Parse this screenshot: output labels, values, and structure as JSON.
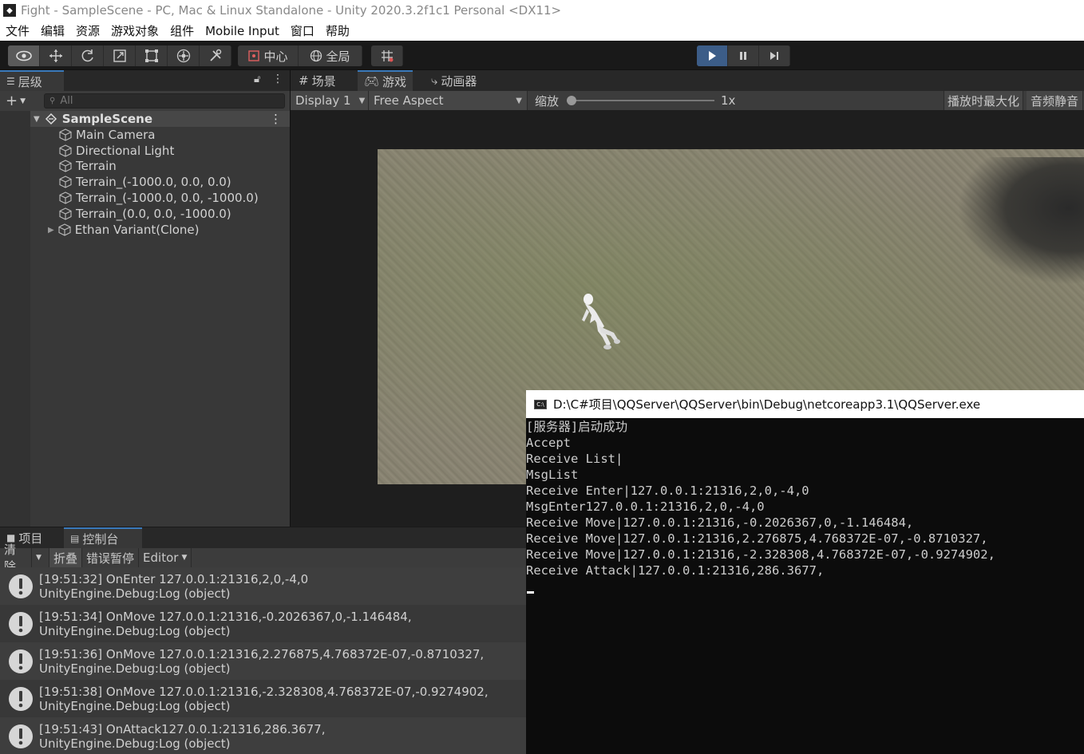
{
  "window": {
    "title": "Fight - SampleScene - PC, Mac & Linux Standalone - Unity 2020.3.2f1c1 Personal <DX11>"
  },
  "menu": [
    "文件",
    "编辑",
    "资源",
    "游戏对象",
    "组件",
    "Mobile Input",
    "窗口",
    "帮助"
  ],
  "toolbar": {
    "pivot_label": "中心",
    "global_label": "全局"
  },
  "hierarchy": {
    "tab_label": "层级",
    "search_placeholder": "All",
    "scene_name": "SampleScene",
    "items": [
      "Main Camera",
      "Directional Light",
      "Terrain",
      "Terrain_(-1000.0, 0.0, 0.0)",
      "Terrain_(-1000.0, 0.0, -1000.0)",
      "Terrain_(0.0, 0.0, -1000.0)",
      "Ethan Variant(Clone)"
    ]
  },
  "game_view": {
    "tabs": [
      "场景",
      "游戏",
      "动画器"
    ],
    "display": "Display 1",
    "aspect": "Free Aspect",
    "scale_label": "缩放",
    "scale_value": "1x",
    "maximize_label": "播放时最大化",
    "mute_label": "音频静音"
  },
  "cmd_window": {
    "title": "D:\\C#项目\\QQServer\\QQServer\\bin\\Debug\\netcoreapp3.1\\QQServer.exe",
    "lines": [
      "[服务器]启动成功",
      "Accept",
      "Receive List|",
      "MsgList",
      "Receive Enter|127.0.0.1:21316,2,0,-4,0",
      "MsgEnter127.0.0.1:21316,2,0,-4,0",
      "Receive Move|127.0.0.1:21316,-0.2026367,0,-1.146484,",
      "Receive Move|127.0.0.1:21316,2.276875,4.768372E-07,-0.8710327,",
      "Receive Move|127.0.0.1:21316,-2.328308,4.768372E-07,-0.9274902,",
      "Receive Attack|127.0.0.1:21316,286.3677,"
    ]
  },
  "console": {
    "tabs": [
      "项目",
      "控制台"
    ],
    "clear_label": "清除",
    "collapse_label": "折叠",
    "error_pause_label": "错误暂停",
    "editor_label": "Editor",
    "logs": [
      {
        "line1": "[19:51:32] OnEnter 127.0.0.1:21316,2,0,-4,0",
        "line2": "UnityEngine.Debug:Log (object)"
      },
      {
        "line1": "[19:51:34] OnMove 127.0.0.1:21316,-0.2026367,0,-1.146484,",
        "line2": "UnityEngine.Debug:Log (object)"
      },
      {
        "line1": "[19:51:36] OnMove 127.0.0.1:21316,2.276875,4.768372E-07,-0.8710327,",
        "line2": "UnityEngine.Debug:Log (object)"
      },
      {
        "line1": "[19:51:38] OnMove 127.0.0.1:21316,-2.328308,4.768372E-07,-0.9274902,",
        "line2": "UnityEngine.Debug:Log (object)"
      },
      {
        "line1": "[19:51:43] OnAttack127.0.0.1:21316,286.3677,",
        "line2": "UnityEngine.Debug:Log (object)"
      }
    ]
  },
  "icons": {
    "play_accent": "#3c5d88",
    "tab_accent": "#3a79bb"
  }
}
